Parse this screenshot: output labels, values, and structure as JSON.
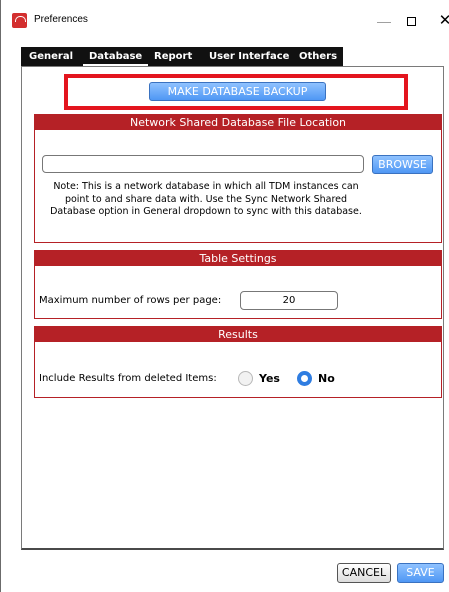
{
  "window": {
    "title": "Preferences",
    "minimize": "—",
    "close": "✕"
  },
  "tabs": [
    {
      "label": "General"
    },
    {
      "label": "Database"
    },
    {
      "label": "Report"
    },
    {
      "label": "User Interface"
    },
    {
      "label": "Others"
    }
  ],
  "active_tab": "Database",
  "backup": {
    "button_label": "MAKE DATABASE BACKUP"
  },
  "network_section": {
    "header": "Network Shared Database File Location",
    "path_value": "",
    "browse_label": "BROWSE",
    "note": "Note: This is a network database in which all TDM instances can point to and share data with. Use the Sync Network Shared Database option in General dropdown to sync with this database."
  },
  "table_section": {
    "header": "Table Settings",
    "rows_label": "Maximum number of rows per page:",
    "rows_value": "20"
  },
  "results_section": {
    "header": "Results",
    "include_label": "Include Results from deleted Items:",
    "yes_label": "Yes",
    "no_label": "No",
    "selected": "No"
  },
  "footer": {
    "cancel_label": "CANCEL",
    "save_label": "SAVE"
  },
  "colors": {
    "section_header": "#b52126",
    "highlight": "#e3151e",
    "blue_button": "#4f97f4",
    "tab_bar": "#111111"
  }
}
